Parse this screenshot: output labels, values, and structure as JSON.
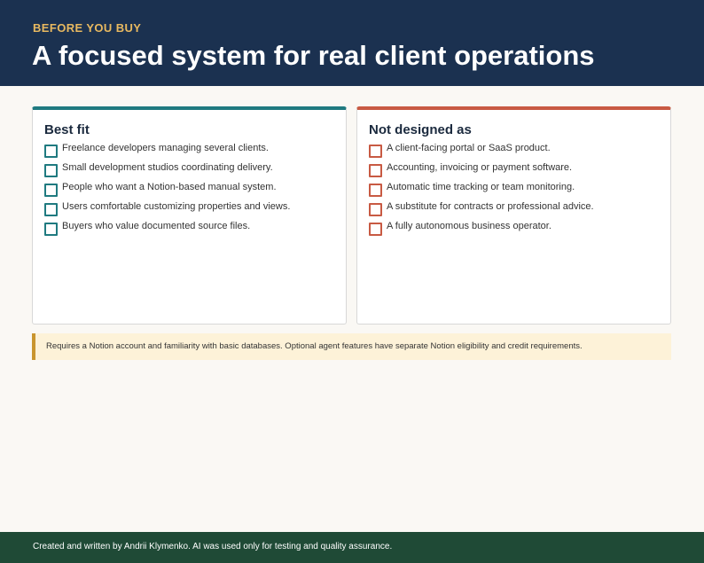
{
  "header": {
    "eyebrow": "BEFORE YOU BUY",
    "title": "A focused system for real client operations"
  },
  "best_fit": {
    "title": "Best fit",
    "items": [
      "Freelance developers managing several clients.",
      "Small development studios coordinating delivery.",
      "People who want a Notion-based manual system.",
      "Users comfortable customizing properties and views.",
      "Buyers who value documented source files."
    ]
  },
  "not_designed": {
    "title": "Not designed as",
    "items": [
      "A client-facing portal or SaaS product.",
      "Accounting, invoicing or payment software.",
      "Automatic time tracking or team monitoring.",
      "A substitute for contracts or professional advice.",
      "A fully autonomous business operator."
    ]
  },
  "note": {
    "text": "Requires a Notion account and familiarity with basic databases. Optional agent features have separate Notion eligibility and credit requirements."
  },
  "footer": {
    "text": "Created and written by Andrii Klymenko. AI was used only for testing and quality assurance."
  },
  "colors": {
    "header_bg": "#1b3150",
    "eyebrow": "#e8b960",
    "fit_accent": "#1f7a80",
    "not_accent": "#c85a43",
    "note_bg": "#fdf2d8",
    "note_accent": "#c9952e",
    "footer_bg": "#1f4a36"
  },
  "icons": {
    "fit_checkbox": "empty-checkbox-teal",
    "not_checkbox": "empty-checkbox-red"
  }
}
